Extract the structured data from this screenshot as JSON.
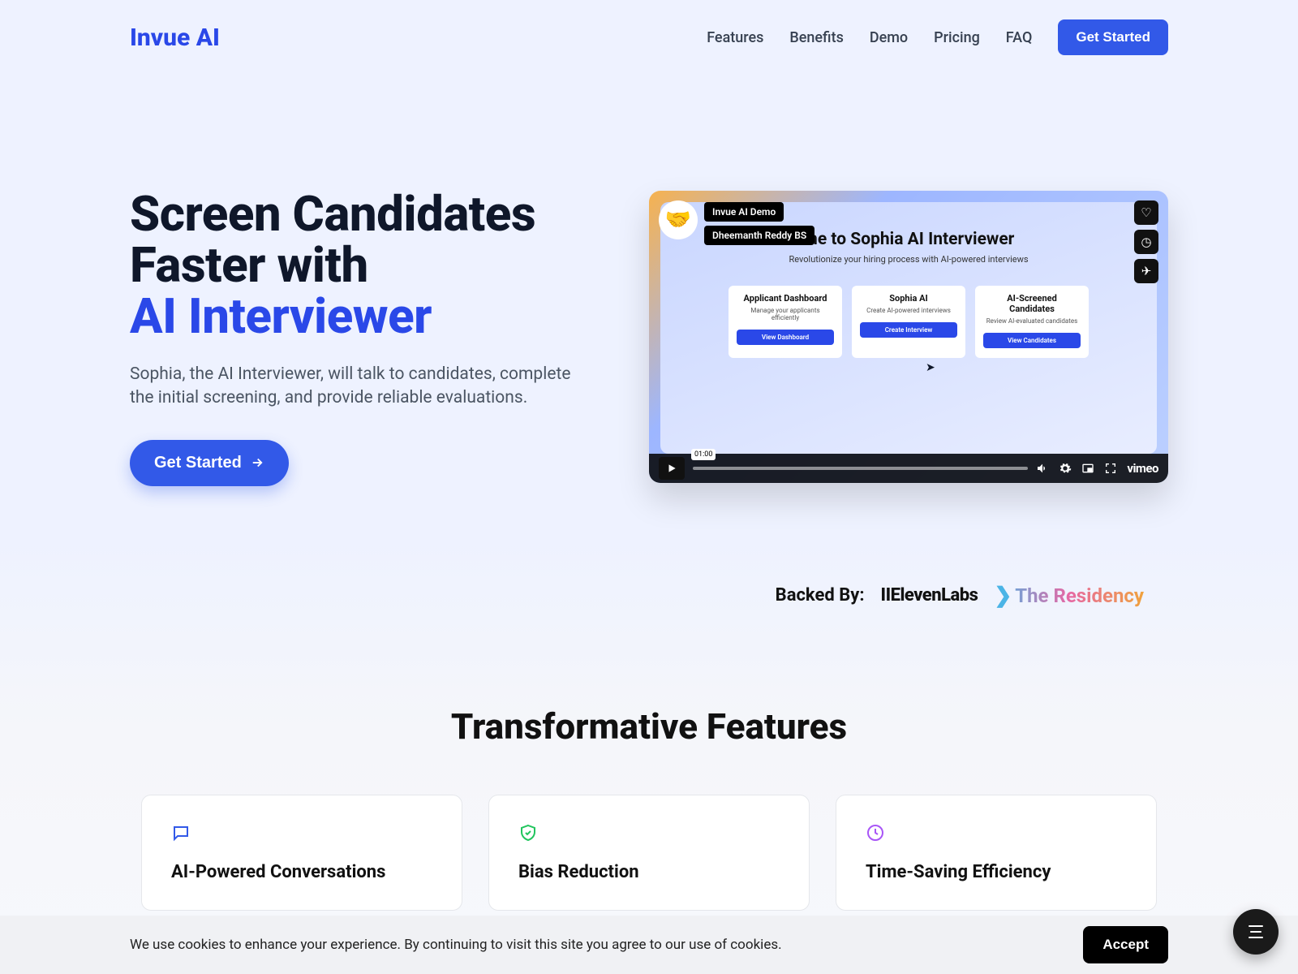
{
  "nav": {
    "logo": "Invue AI",
    "links": [
      "Features",
      "Benefits",
      "Demo",
      "Pricing",
      "FAQ"
    ],
    "cta": "Get Started"
  },
  "hero": {
    "title_plain": "Screen Candidates Faster with",
    "title_accent": "AI Interviewer",
    "subtitle": "Sophia, the AI Interviewer, will talk to candidates, complete the initial screening, and provide reliable evaluations.",
    "cta": "Get Started"
  },
  "video": {
    "badge_top": "Invue AI Demo",
    "badge_bottom": "Dheemanth Reddy BS",
    "title": "me to Sophia AI Interviewer",
    "subtitle": "Revolutionize your hiring process with AI-powered interviews",
    "time": "01:00",
    "provider": "vimeo",
    "cards": [
      {
        "title": "Applicant Dashboard",
        "sub": "Manage your applicants efficiently",
        "btn": "View Dashboard"
      },
      {
        "title": "Sophia AI",
        "sub": "Create AI-powered interviews",
        "btn": "Create Interview"
      },
      {
        "title": "AI-Screened Candidates",
        "sub": "Review AI-evaluated candidates",
        "btn": "View Candidates"
      }
    ]
  },
  "backed": {
    "label": "Backed By:",
    "b1": "IIElevenLabs",
    "b2": "The Residency"
  },
  "features": {
    "heading": "Transformative Features",
    "cards": [
      {
        "title": "AI-Powered Conversations",
        "icon_color": "#3259e8"
      },
      {
        "title": "Bias Reduction",
        "icon_color": "#22c55e"
      },
      {
        "title": "Time-Saving Efficiency",
        "icon_color": "#a855f7"
      }
    ]
  },
  "cookie": {
    "text": "We use cookies to enhance your experience. By continuing to visit this site you agree to our use of cookies.",
    "accept": "Accept"
  }
}
